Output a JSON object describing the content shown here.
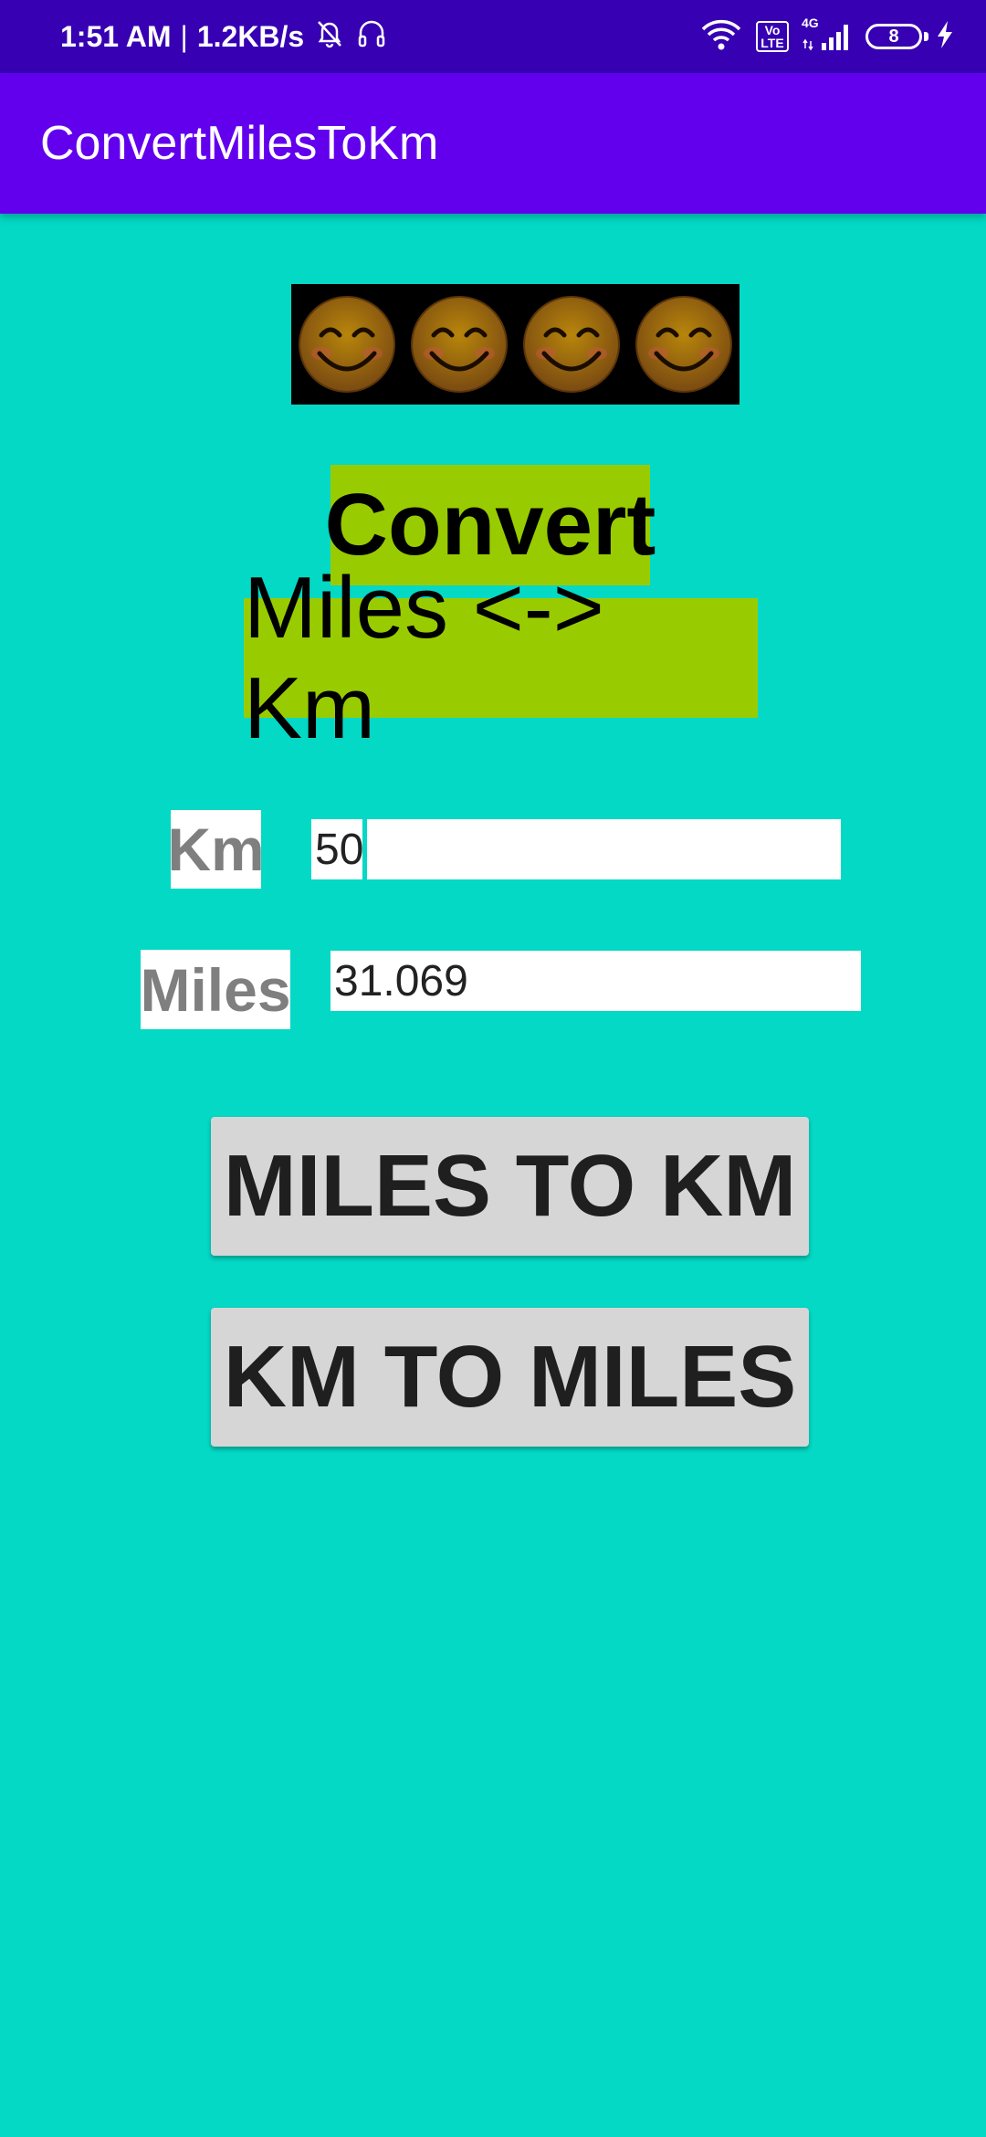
{
  "status_bar": {
    "time": "1:51 AM",
    "separator": "|",
    "speed": "1.2KB/s",
    "volte": "Vo LTE",
    "network": "4G",
    "battery_level": "8",
    "icons": [
      "mute-bell-icon",
      "headset-icon",
      "wifi-icon",
      "volte-icon",
      "signal-icon",
      "battery-icon",
      "charging-icon"
    ]
  },
  "app_bar": {
    "title": "ConvertMilesToKm"
  },
  "main": {
    "emoji_count": 4,
    "heading_line1": "Convert",
    "heading_line2": "Miles <-> Km",
    "km_label": "Km",
    "miles_label": "Miles",
    "km_value": "50",
    "km_input_value": "",
    "miles_value": "31.069",
    "button_miles_to_km": "MILES TO KM",
    "button_km_to_miles": "KM TO MILES"
  },
  "colors": {
    "background": "#03d9c5",
    "status_bar": "#3700b3",
    "app_bar": "#6200ee",
    "heading_bg": "#99cc00",
    "button_bg": "#d6d6d6",
    "label_text": "#7f7f7f"
  }
}
